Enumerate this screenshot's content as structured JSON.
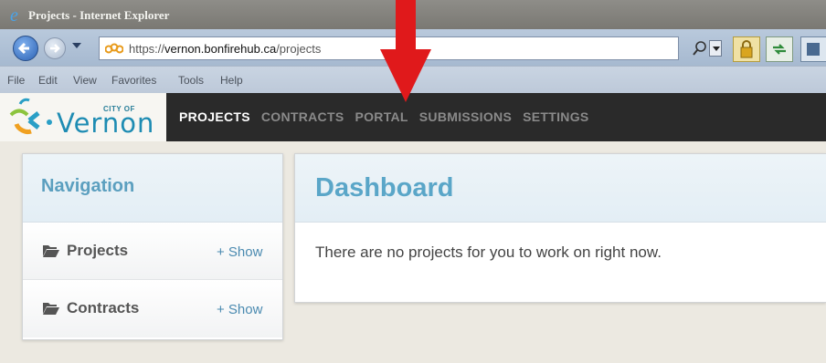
{
  "browser": {
    "window_title": "Projects - Internet Explorer",
    "url_prefix": "https://",
    "url_domain": "vernon.bonfirehub.ca",
    "url_path": "/projects",
    "menu": [
      "File",
      "Edit",
      "View",
      "Favorites",
      "Tools",
      "Help"
    ]
  },
  "site": {
    "logo_city_of": "CITY OF",
    "logo_name": "Vernon",
    "nav": [
      {
        "label": "PROJECTS",
        "active": true
      },
      {
        "label": "CONTRACTS",
        "active": false
      },
      {
        "label": "PORTAL",
        "active": false
      },
      {
        "label": "SUBMISSIONS",
        "active": false
      },
      {
        "label": "SETTINGS",
        "active": false
      }
    ]
  },
  "sidebar": {
    "title": "Navigation",
    "items": [
      {
        "label": "Projects",
        "action": "+ Show"
      },
      {
        "label": "Contracts",
        "action": "+ Show"
      }
    ]
  },
  "main": {
    "title": "Dashboard",
    "message": "There are no projects for you to work on right now."
  },
  "colors": {
    "accent": "#5aa6c8",
    "header_bg": "#2a2a2a",
    "arrow": "#e0191b"
  }
}
